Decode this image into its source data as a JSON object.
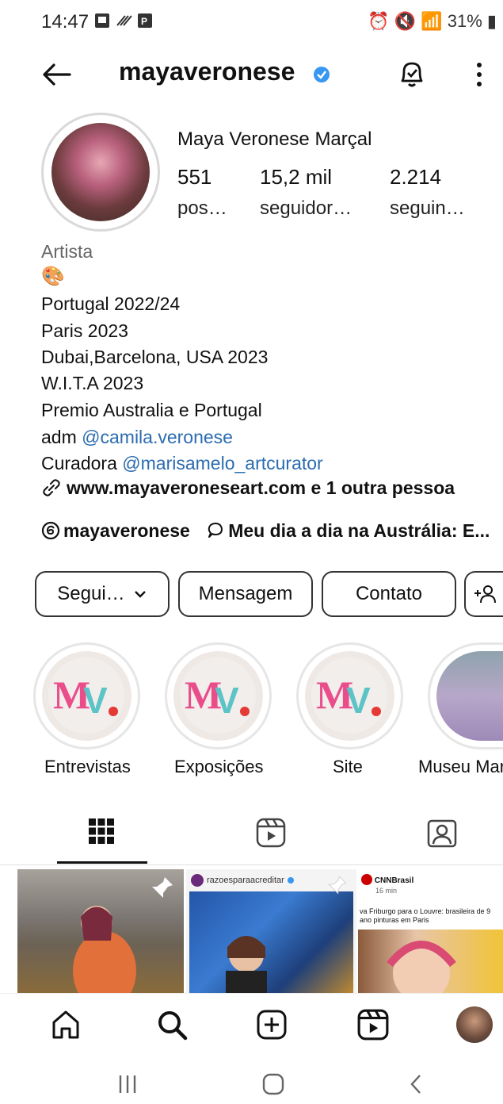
{
  "status": {
    "time": "14:47",
    "battery": "31%"
  },
  "profile": {
    "username": "mayaveronese",
    "full_name": "Maya Veronese Marçal",
    "stats": [
      {
        "value": "551",
        "label": "pos…"
      },
      {
        "value": "15,2 mil",
        "label": "seguidor…"
      },
      {
        "value": "2.214",
        "label": "seguin…"
      }
    ],
    "category": "Artista",
    "emoji": "🎨",
    "bio": [
      "Portugal 2022/24",
      "Paris 2023",
      "Dubai,Barcelona, USA 2023",
      "W.I.T.A 2023",
      "Premio Australia e Portugal"
    ],
    "adm_prefix": "adm ",
    "adm_mention": "@camila.veronese",
    "curator_prefix": "Curadora ",
    "curator_mention": "@marisamelo_artcurator",
    "link": "www.mayaveroneseart.com e 1 outra pessoa",
    "threads": "mayaveronese",
    "thread_note": "Meu dia a dia na Austrália: E..."
  },
  "buttons": {
    "follow": "Segui…",
    "message": "Mensagem",
    "contact": "Contato"
  },
  "highlights": [
    {
      "label": "Entrevistas"
    },
    {
      "label": "Exposições"
    },
    {
      "label": "Site"
    },
    {
      "label": "Museu Mar"
    }
  ],
  "posts": [
    {
      "account": "",
      "caption": ""
    },
    {
      "account": "razoesparaacreditar",
      "caption": ""
    },
    {
      "account": "CNNBrasil",
      "time": "16 min",
      "caption": "va Friburgo para o Louvre: brasileira de 9 ano pinturas em Paris"
    }
  ],
  "colors": {
    "verified": "#3897f0",
    "link": "#2b6cb0",
    "mv_pink": "#e94e8b",
    "mv_teal": "#5cc3c6",
    "mv_red": "#e53935"
  }
}
